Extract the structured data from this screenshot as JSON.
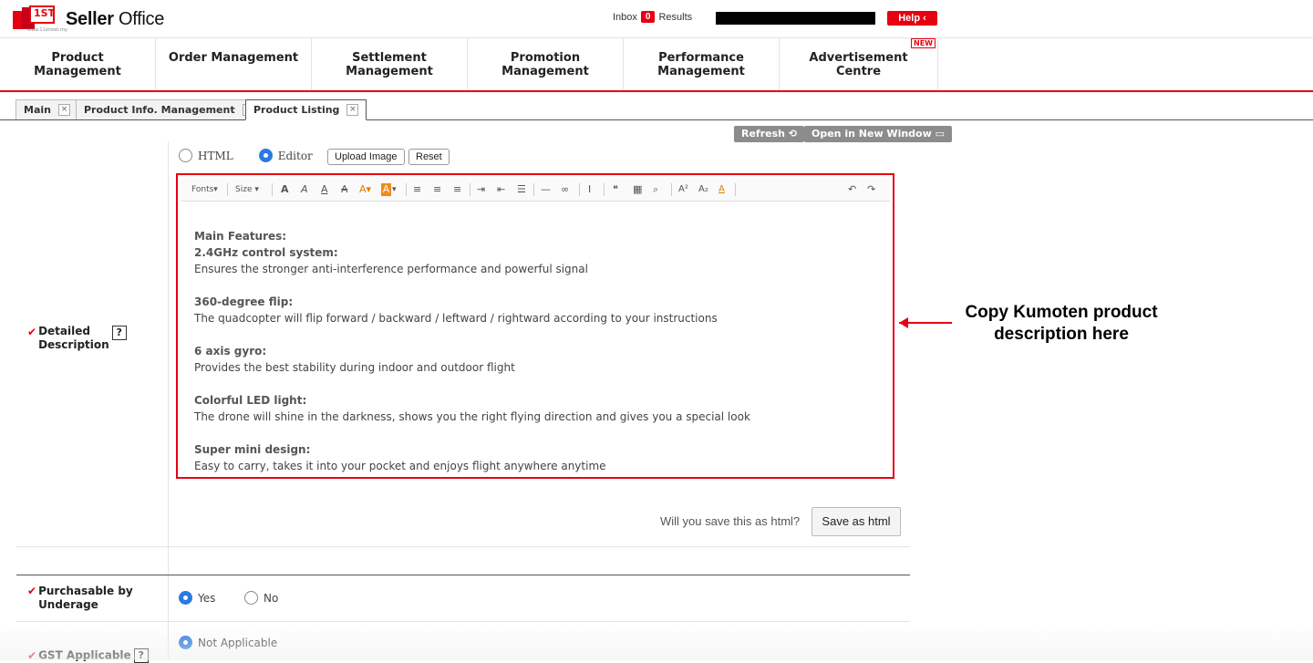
{
  "header": {
    "logo_badge_text": "1ST",
    "logo_badge_sub": "www.11street.my",
    "logo_title_bold": "Seller",
    "logo_title_rest": " Office",
    "inbox_label": "Inbox",
    "inbox_count": "0",
    "results_label": "Results",
    "help_label": "Help ‹"
  },
  "nav": {
    "items": [
      {
        "label": "Product\nManagement"
      },
      {
        "label": "Order Management"
      },
      {
        "label": "Settlement\nManagement"
      },
      {
        "label": "Promotion\nManagement"
      },
      {
        "label": "Performance\nManagement"
      },
      {
        "label": "Advertisement\nCentre",
        "badge": "NEW"
      }
    ]
  },
  "tabs": [
    {
      "label": "Main",
      "close": "×"
    },
    {
      "label": "Product Info. Management",
      "close": "×"
    },
    {
      "label": "Product Listing",
      "close": "×",
      "active": true
    }
  ],
  "toolbar": {
    "refresh_label": "Refresh ⟲",
    "open_new_window_label": "Open in New Window ▭"
  },
  "editor_modes": {
    "html_label": "HTML",
    "editor_label": "Editor",
    "selected": "Editor",
    "upload_image_label": "Upload Image",
    "reset_label": "Reset"
  },
  "editor_toolbar": {
    "fonts_label": "Fonts▾",
    "size_label": "Size ▾"
  },
  "editor_content": {
    "lines": [
      {
        "text": "Main Features:",
        "bold": true
      },
      {
        "text": "2.4GHz control system:",
        "bold": true
      },
      {
        "text": "Ensures the stronger anti-interference performance and powerful signal",
        "bold": false
      },
      {
        "text": "",
        "bold": false
      },
      {
        "text": "360-degree flip:",
        "bold": true
      },
      {
        "text": "The quadcopter will flip forward / backward / leftward / rightward according to your instructions",
        "bold": false
      },
      {
        "text": "",
        "bold": false
      },
      {
        "text": "6 axis gyro:",
        "bold": true
      },
      {
        "text": "Provides the best stability during indoor and outdoor flight",
        "bold": false
      },
      {
        "text": "",
        "bold": false
      },
      {
        "text": "Colorful LED light:",
        "bold": true
      },
      {
        "text": "The drone will shine in the darkness, shows you the right flying direction and gives you a special look",
        "bold": false
      },
      {
        "text": "",
        "bold": false
      },
      {
        "text": "Super mini design:",
        "bold": true
      },
      {
        "text": "Easy to carry, takes it into your pocket and enjoys flight anywhere anytime",
        "bold": false
      }
    ]
  },
  "annotation": {
    "text": "Copy Kumoten product description here"
  },
  "save_html": {
    "question": "Will you save this as html?",
    "button_label": "Save as html"
  },
  "fields": {
    "detailed_description": {
      "check": "✔",
      "label": "Detailed\nDescription",
      "help": "?"
    },
    "purchasable": {
      "check": "✔",
      "label": "Purchasable by\nUnderage",
      "options": [
        "Yes",
        "No"
      ],
      "selected": "Yes"
    },
    "gst": {
      "check": "✔",
      "label": "GST Applicable",
      "help": "?",
      "options": [
        "Not Applicable"
      ],
      "selected": "Not Applicable"
    }
  },
  "colors": {
    "brand_red": "#e60012",
    "radio_blue": "#2a7ae2",
    "toolbar_gray": "#8c8c8c"
  }
}
